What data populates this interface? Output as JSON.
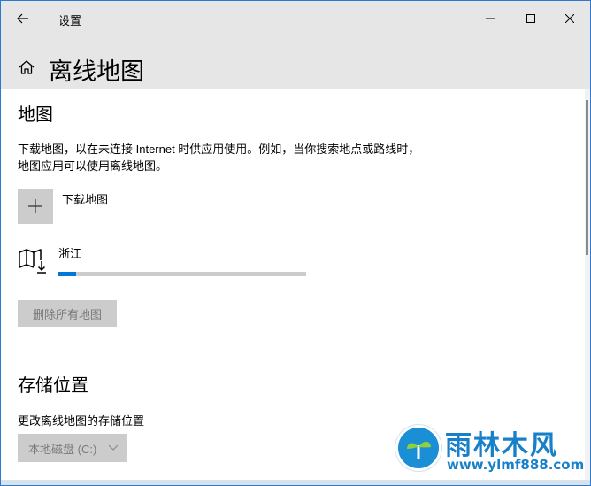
{
  "window": {
    "title": "设置"
  },
  "page": {
    "title": "离线地图"
  },
  "maps_section": {
    "title": "地图",
    "description": "下载地图，以在未连接 Internet 时供应用使用。例如，当你搜索地点或路线时，地图应用可以使用离线地图。",
    "download_label": "下载地图",
    "downloads": [
      {
        "name": "浙江",
        "progress": 0.07
      }
    ],
    "delete_all_label": "删除所有地图"
  },
  "storage_section": {
    "title": "存储位置",
    "label": "更改离线地图的存储位置",
    "selected_drive": "本地磁盘 (C:)"
  },
  "watermark": {
    "title": "雨林木风",
    "url": "www.ylmf888.com"
  },
  "icons": {
    "back": "back-arrow-icon",
    "home": "home-icon",
    "add": "plus-icon",
    "map": "map-download-icon",
    "chevron": "chevron-down-icon"
  },
  "colors": {
    "accent": "#0078d7",
    "header_bg": "#e6e6e6",
    "disabled_bg": "#cccccc"
  }
}
